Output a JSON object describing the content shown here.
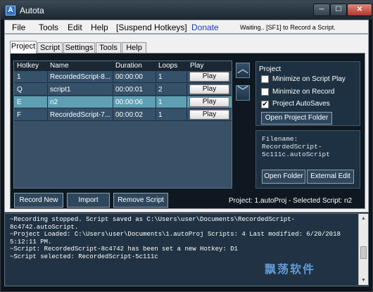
{
  "window": {
    "title": "Autota",
    "icon_letter": "A",
    "min": "─",
    "max": "☐",
    "close": "✕"
  },
  "menu": {
    "file": "File",
    "tools": "Tools",
    "edit": "Edit",
    "help": "Help",
    "suspend": "[Suspend Hotkeys]",
    "donate": "Donate",
    "status": "Waiting.. [SF1] to Record a Script.",
    "donate_color": "#1a3db5"
  },
  "tabs": [
    "Project",
    "Script",
    "Settings",
    "Tools",
    "Help"
  ],
  "grid": {
    "headers": {
      "hotkey": "Hotkey",
      "name": "Name",
      "duration": "Duration",
      "loops": "Loops",
      "play": "Play"
    },
    "rows": [
      {
        "hotkey": "1",
        "name": "RecordedScript-8...",
        "duration": "00:00:00",
        "loops": "1",
        "play": "Play"
      },
      {
        "hotkey": "Q",
        "name": "script1",
        "duration": "00:00:01",
        "loops": "2",
        "play": "Play"
      },
      {
        "hotkey": "E",
        "name": "n2",
        "duration": "00:00:06",
        "loops": "1",
        "play": "Play"
      },
      {
        "hotkey": "F",
        "name": "RecordedScript-7...",
        "duration": "00:00:02",
        "loops": "1",
        "play": "Play"
      }
    ],
    "selected_row_color": "#5f9fb3"
  },
  "move": {
    "up": "︿",
    "down": "﹀"
  },
  "project": {
    "title": "Project",
    "minimize_on_play": {
      "label": "Minimize on Script Play",
      "checked": ""
    },
    "minimize_on_record": {
      "label": "Minimize on Record",
      "checked": ""
    },
    "autosaves": {
      "label": "Project AutoSaves",
      "checked": "✔"
    },
    "open_folder": "Open Project Folder"
  },
  "file": {
    "label": "Filename:",
    "value": "RecordedScript-5c111c.autoScript",
    "open_folder": "Open Folder",
    "external_edit": "External Edit"
  },
  "bottom": {
    "record_new": "Record New",
    "import": "Import",
    "remove": "Remove Script",
    "info": "Project: 1.autoProj - Selected Script: n2"
  },
  "log": [
    "~Recording stopped.  Script saved as C:\\Users\\user\\Documents\\RecordedScript-8c4742.autoScript.",
    "~Project Loaded: C:\\Users\\user\\Documents\\1.autoProj Scripts: 4 Last modified: 6/20/2018 5:12:11 PM.",
    "~Script: RecordedScript-8c4742 has been set a new Hotkey: D1",
    "~Script selected: RecordedScript-5c111c"
  ],
  "scroll": {
    "up": "▲",
    "down": "▼"
  },
  "watermark": "飘荡软件"
}
